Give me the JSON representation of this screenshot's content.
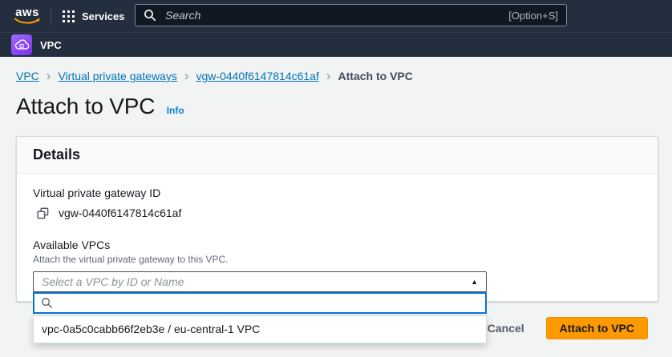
{
  "topnav": {
    "logo_text": "aws",
    "services_label": "Services",
    "search_placeholder": "Search",
    "search_shortcut": "[Option+S]",
    "app_label": "VPC"
  },
  "breadcrumb": {
    "items": [
      {
        "label": "VPC"
      },
      {
        "label": "Virtual private gateways"
      },
      {
        "label": "vgw-0440f6147814c61af"
      },
      {
        "label": "Attach to VPC"
      }
    ]
  },
  "page": {
    "title": "Attach to VPC",
    "info_label": "Info"
  },
  "details": {
    "heading": "Details",
    "gateway_id_label": "Virtual private gateway ID",
    "gateway_id_value": "vgw-0440f6147814c61af",
    "available_vpcs_label": "Available VPCs",
    "available_vpcs_description": "Attach the virtual private gateway to this VPC.",
    "select_placeholder": "Select a VPC by ID or Name",
    "filter_value": "",
    "options": [
      {
        "label": "vpc-0a5c0cabb66f2eb3e / eu-central-1 VPC"
      }
    ]
  },
  "actions": {
    "cancel_label": "Cancel",
    "submit_label": "Attach to VPC"
  },
  "icons": {
    "breadcrumb_separator": "›",
    "dropdown_open_arrow": "▲"
  },
  "colors": {
    "nav_bg": "#232f3e",
    "accent_orange": "#ff9900",
    "link_blue": "#0073bb",
    "focus_blue": "#0972d3",
    "vpc_icon_purple": "#8c4fff",
    "page_bg": "#f2f3f3"
  }
}
